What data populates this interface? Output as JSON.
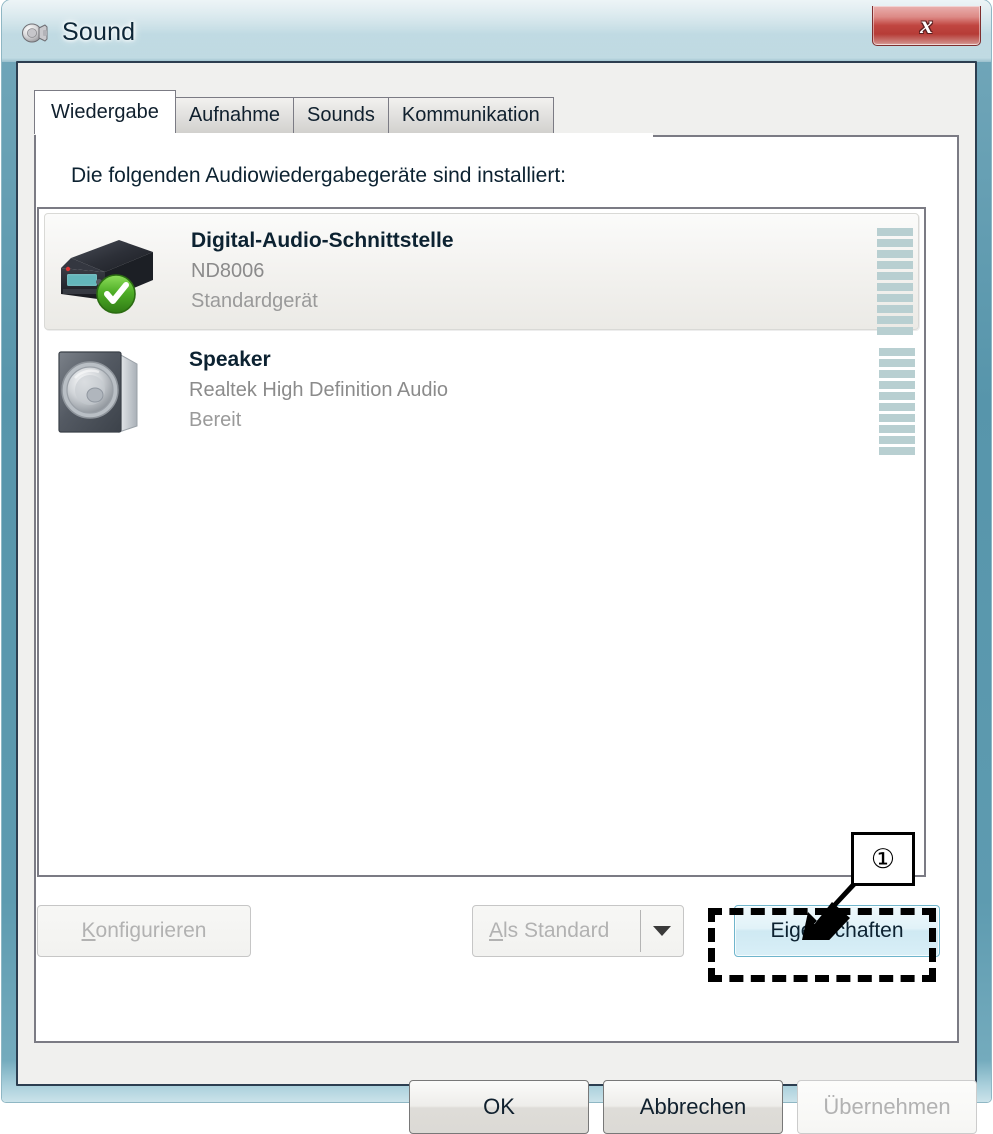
{
  "window": {
    "title": "Sound",
    "icon": "sound-speaker-icon",
    "close_label": "x"
  },
  "tabs": [
    {
      "label": "Wiedergabe",
      "active": true
    },
    {
      "label": "Aufnahme",
      "active": false
    },
    {
      "label": "Sounds",
      "active": false
    },
    {
      "label": "Kommunikation",
      "active": false
    }
  ],
  "panel": {
    "heading": "Die folgenden Audiowiedergabegeräte sind installiert:"
  },
  "devices": [
    {
      "name": "Digital-Audio-Schnittstelle",
      "subtitle": "ND8006",
      "status": "Standardgerät",
      "selected": true,
      "default": true,
      "icon": "digital-audio-device-icon",
      "meter_segments": 10,
      "meter_active": 0
    },
    {
      "name": "Speaker",
      "subtitle": "Realtek High Definition Audio",
      "status": "Bereit",
      "selected": false,
      "default": false,
      "icon": "speaker-icon",
      "meter_segments": 10,
      "meter_active": 0
    }
  ],
  "mid_buttons": {
    "configure": {
      "label": "Konfigurieren",
      "accel": "K",
      "enabled": false
    },
    "set_default": {
      "label": "Als Standard",
      "accel": "A",
      "enabled": false,
      "has_dropdown": true
    },
    "properties": {
      "label": "Eigenschaften",
      "enabled": true,
      "highlighted": true
    }
  },
  "bottom_buttons": [
    {
      "label": "OK",
      "enabled": true
    },
    {
      "label": "Abbrechen",
      "enabled": true
    },
    {
      "label": "Übernehmen",
      "enabled": false
    }
  ],
  "annotation": {
    "number": "①",
    "target": "Eigenschaften"
  },
  "colors": {
    "glass": "#5795ab",
    "close_red": "#c04540",
    "meter_segment": "#b8cfd1",
    "highlight_border": "#6fb5cc",
    "text": "#0c2231",
    "muted_text": "#8b8b8b"
  }
}
